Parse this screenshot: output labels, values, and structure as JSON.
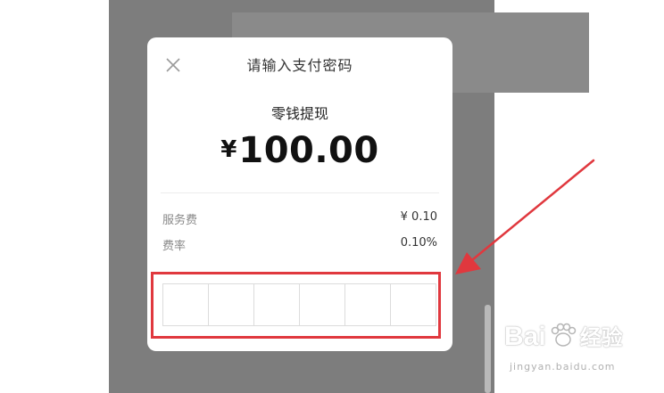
{
  "dialog": {
    "title": "请输入支付密码",
    "subtitle": "零钱提现",
    "currency_symbol": "¥",
    "amount": "100.00",
    "fee_label": "服务费",
    "fee_value": "¥ 0.10",
    "rate_label": "费率",
    "rate_value": "0.10%",
    "pin_length": 6
  },
  "annotation": {
    "color": "#e0383e"
  },
  "watermark": {
    "brand": "Bai",
    "brand_cn": "经验",
    "url": "jingyan.baidu.com"
  }
}
